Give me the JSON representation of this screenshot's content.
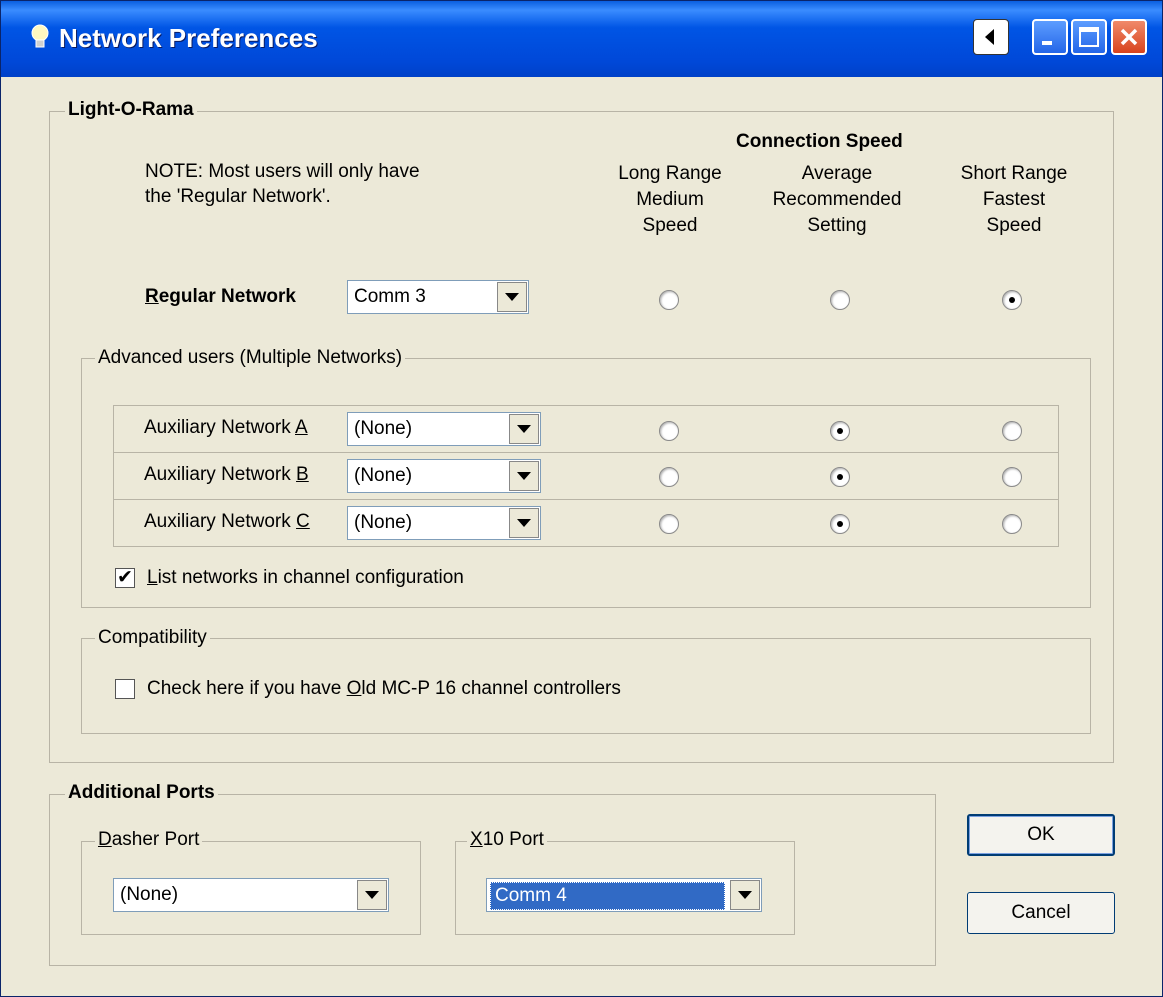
{
  "window": {
    "title": "Network Preferences"
  },
  "lor": {
    "group_label": "Light-O-Rama",
    "note_line1": "NOTE: Most users will only have",
    "note_line2": "the 'Regular Network'.",
    "speed_title": "Connection Speed",
    "columns": [
      {
        "line1": "Long Range",
        "line2": "Medium",
        "line3": "Speed"
      },
      {
        "line1": "Average",
        "line2": "Recommended",
        "line3": "Setting"
      },
      {
        "line1": "Short Range",
        "line2": "Fastest",
        "line3": "Speed"
      }
    ],
    "regular": {
      "label_mnemonic": "R",
      "label_rest": "egular Network",
      "value": "Comm 3",
      "speed": 2
    }
  },
  "advanced": {
    "group_label": "Advanced users (Multiple Networks)",
    "rows": [
      {
        "label_prefix": "Auxiliary Network ",
        "mnemonic": "A",
        "value": "(None)",
        "speed": 1
      },
      {
        "label_prefix": "Auxiliary Network ",
        "mnemonic": "B",
        "value": "(None)",
        "speed": 1
      },
      {
        "label_prefix": "Auxiliary Network ",
        "mnemonic": "C",
        "value": "(None)",
        "speed": 1
      }
    ],
    "list_networks": {
      "mnemonic": "L",
      "rest": "ist networks in channel configuration",
      "checked": true
    }
  },
  "compat": {
    "group_label": "Compatibility",
    "check_prefix": "Check here if you have ",
    "check_mnemonic": "O",
    "check_rest": "ld MC-P 16 channel controllers",
    "checked": false
  },
  "ports": {
    "group_label": "Additional Ports",
    "dasher": {
      "mnemonic": "D",
      "rest": "asher Port",
      "value": "(None)"
    },
    "x10": {
      "mnemonic": "X",
      "rest": "10 Port",
      "value": "Comm 4"
    }
  },
  "buttons": {
    "ok": "OK",
    "cancel": "Cancel"
  },
  "colors": {
    "titlebar": "#0054e3",
    "face": "#ece9d8",
    "selection": "#316ac5"
  }
}
